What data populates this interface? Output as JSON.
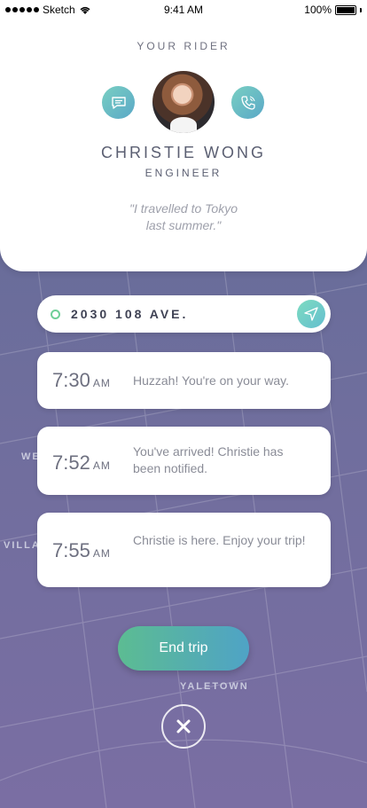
{
  "status_bar": {
    "carrier": "Sketch",
    "time": "9:41 AM",
    "battery": "100%"
  },
  "rider": {
    "heading": "YOUR RIDER",
    "name": "CHRISTIE WONG",
    "role": "ENGINEER",
    "quote_line1": "\"I travelled to Tokyo",
    "quote_line2": "last summer.\""
  },
  "address": {
    "text": "2030 108 AVE."
  },
  "timeline": [
    {
      "time": "7:30",
      "period": "AM",
      "message": "Huzzah! You're on your way."
    },
    {
      "time": "7:52",
      "period": "AM",
      "message": "You've arrived! Christie has been notified."
    },
    {
      "time": "7:55",
      "period": "AM",
      "message": "Christie is here. Enjoy your trip!"
    }
  ],
  "actions": {
    "end_trip": "End trip"
  },
  "map_labels": [
    "YALETOWN",
    "WE",
    "VILLA"
  ],
  "colors": {
    "accent_start": "#5cbc92",
    "accent_end": "#4fa3c6",
    "background": "#6f6e9d"
  },
  "icons": [
    "message-icon",
    "phone-icon",
    "location-pin-icon",
    "navigation-arrow-icon",
    "close-icon",
    "wifi-icon",
    "battery-icon"
  ]
}
